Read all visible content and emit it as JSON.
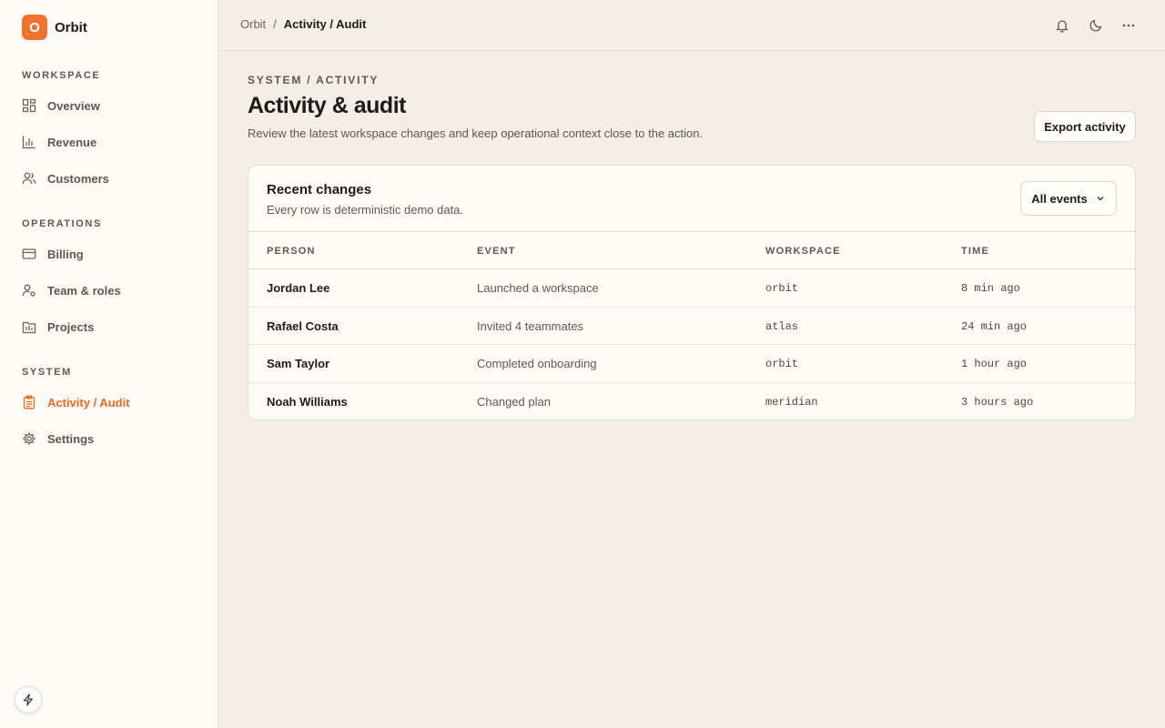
{
  "brand": {
    "logo_letter": "O",
    "name": "Orbit",
    "accent": "#f0742e"
  },
  "sidebar": {
    "sections": [
      {
        "label": "WORKSPACE"
      },
      {
        "label": "OPERATIONS"
      },
      {
        "label": "SYSTEM"
      }
    ],
    "items": [
      {
        "label": "Overview",
        "icon": "dashboard-icon"
      },
      {
        "label": "Revenue",
        "icon": "bar-chart-icon"
      },
      {
        "label": "Customers",
        "icon": "users-icon"
      },
      {
        "label": "Billing",
        "icon": "credit-card-icon"
      },
      {
        "label": "Team & roles",
        "icon": "user-cog-icon"
      },
      {
        "label": "Projects",
        "icon": "kanban-icon"
      },
      {
        "label": "Activity / Audit",
        "icon": "clipboard-icon",
        "active": true
      },
      {
        "label": "Settings",
        "icon": "gear-icon"
      }
    ]
  },
  "header": {
    "breadcrumb": {
      "root": "Orbit",
      "separator": "/",
      "current": "Activity / Audit"
    },
    "icons": [
      "bell-icon",
      "moon-icon",
      "more-icon"
    ]
  },
  "page": {
    "eyebrow": "SYSTEM / ACTIVITY",
    "title": "Activity & audit",
    "subtitle": "Review the latest workspace changes and keep operational context close to the action.",
    "export_label": "Export activity"
  },
  "card": {
    "title": "Recent changes",
    "subtitle": "Every row is deterministic demo data.",
    "filter_label": "All events",
    "columns": [
      "PERSON",
      "EVENT",
      "WORKSPACE",
      "TIME"
    ],
    "rows": [
      {
        "person": "Jordan Lee",
        "event": "Launched a workspace",
        "workspace": "orbit",
        "time": "8 min ago"
      },
      {
        "person": "Rafael Costa",
        "event": "Invited 4 teammates",
        "workspace": "atlas",
        "time": "24 min ago"
      },
      {
        "person": "Sam Taylor",
        "event": "Completed onboarding",
        "workspace": "orbit",
        "time": "1 hour ago"
      },
      {
        "person": "Noah Williams",
        "event": "Changed plan",
        "workspace": "meridian",
        "time": "3 hours ago"
      }
    ]
  }
}
